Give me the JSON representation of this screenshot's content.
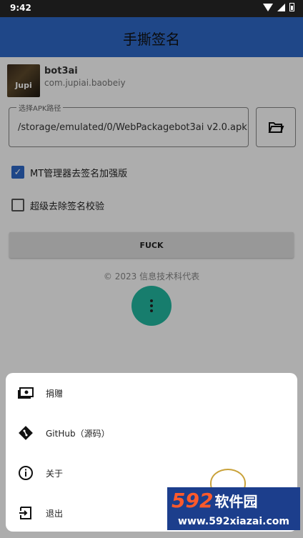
{
  "status_bar": {
    "time": "9:42"
  },
  "app_bar": {
    "title": "手撕签名"
  },
  "app_info": {
    "icon_text": "Jupi",
    "name": "bot3ai",
    "package": "com.jupiai.baobeiy"
  },
  "apk_field": {
    "label": "选择APK路径",
    "value": "/storage/emulated/0/WebPackagebot3ai v2.0.apk"
  },
  "options": [
    {
      "label": "MT管理器去签名加强版",
      "checked": true
    },
    {
      "label": "超级去除签名校验",
      "checked": false
    }
  ],
  "action_button": {
    "label": "FUCK"
  },
  "footer": {
    "copyright": "© 2023 信息技术科代表"
  },
  "sheet": {
    "items": [
      {
        "icon": "money-icon",
        "label": "捐赠"
      },
      {
        "icon": "git-icon",
        "label": "GitHub（源码）"
      },
      {
        "icon": "info-icon",
        "label": "关于"
      },
      {
        "icon": "exit-icon",
        "label": "退出"
      }
    ]
  },
  "watermark": {
    "brand_number": "592",
    "brand_text": "软件园",
    "url": "www.592xiazai.com"
  },
  "colors": {
    "primary": "#2f69c9",
    "fab": "#23b9a1",
    "status_bar": "#1a1a1a"
  }
}
